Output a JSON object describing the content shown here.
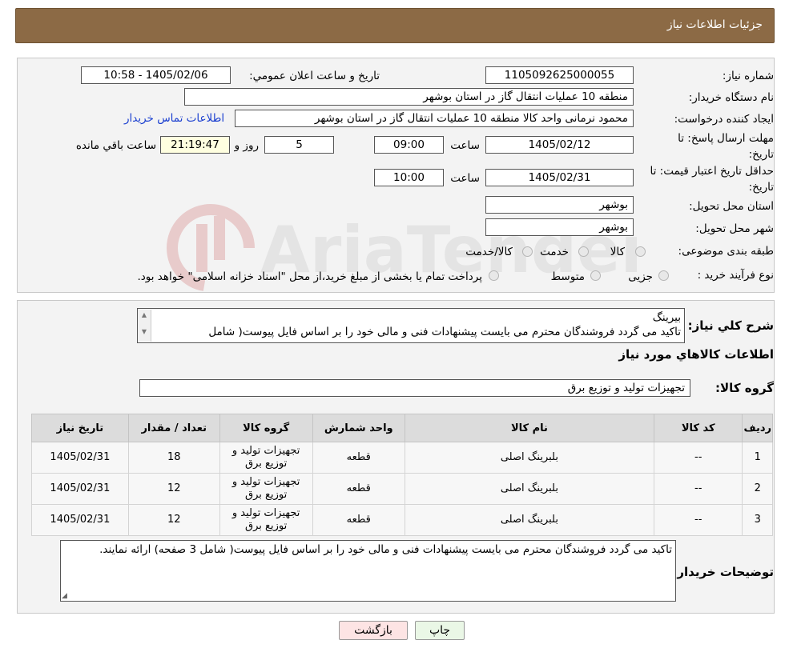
{
  "header": {
    "title": "جزئيات اطلاعات نياز"
  },
  "form": {
    "need_number_label": "شماره نياز:",
    "need_number": "1105092625000055",
    "announce_label": "تاريخ و ساعت اعلان عمومي:",
    "announce_value": "1405/02/06 - 10:58",
    "buyer_org_label": "نام دستگاه خريدار:",
    "buyer_org": "منطقه 10 عملیات انتقال گاز در استان بوشهر",
    "creator_label": "ايجاد کننده درخواست:",
    "creator": "محمود نرمانی واحد کالا منطقه 10 عملیات انتقال گاز در استان بوشهر",
    "contact_link": "اطلاعات تماس خريدار",
    "deadline_label": "مهلت ارسال پاسخ: تا تاريخ:",
    "deadline_date": "1405/02/12",
    "time_label": "ساعت",
    "deadline_time": "09:00",
    "days_value": "5",
    "days_label": "روز و",
    "remaining_value": "21:19:47",
    "remaining_label": "ساعت باقي مانده",
    "validity_label": "حداقل تاريخ اعتبار قيمت: تا تاريخ:",
    "validity_date": "1405/02/31",
    "validity_time_label": "ساعت",
    "validity_time": "10:00",
    "province_label": "استان محل تحويل:",
    "province": "بوشهر",
    "city_label": "شهر محل تحويل:",
    "city": "بوشهر",
    "category_label": "طبقه بندی موضوعی:",
    "category_options": [
      "کالا",
      "خدمت",
      "کالا/خدمت"
    ],
    "purchase_type_label": "نوع فرآيند خريد :",
    "purchase_options": [
      "جزیی",
      "متوسط"
    ],
    "purchase_note": "پرداخت تمام يا بخشی از مبلغ خريد،از محل \"اسناد خزانه اسلامی\" خواهد بود."
  },
  "watermark_text": "AriaTender.neT",
  "description": {
    "label": "شرح کلي نياز:",
    "line1": "بیرینگ",
    "line2": "تاکید می گردد فروشندگان محترم می بایست پیشنهادات فنی و مالی خود را بر اساس فایل پیوست( شامل"
  },
  "goods": {
    "section_title": "اطلاعات کالاهاي مورد نياز",
    "group_label": "گروه کالا:",
    "group_value": "تجهیزات تولید و توزیع برق",
    "columns": [
      "رديف",
      "کد کالا",
      "نام کالا",
      "واحد شمارش",
      "گروه کالا",
      "تعداد / مقدار",
      "تاريخ نياز"
    ],
    "rows": [
      {
        "row": "1",
        "code": "--",
        "name": "بلبرینگ اصلی",
        "unit": "قطعه",
        "group_l1": "تجهیزات تولید و",
        "group_l2": "توزیع برق",
        "qty": "18",
        "date": "1405/02/31"
      },
      {
        "row": "2",
        "code": "--",
        "name": "بلبرینگ اصلی",
        "unit": "قطعه",
        "group_l1": "تجهیزات تولید و",
        "group_l2": "توزیع برق",
        "qty": "12",
        "date": "1405/02/31"
      },
      {
        "row": "3",
        "code": "--",
        "name": "بلبرینگ اصلی",
        "unit": "قطعه",
        "group_l1": "تجهیزات تولید و",
        "group_l2": "توزیع برق",
        "qty": "12",
        "date": "1405/02/31"
      }
    ]
  },
  "buyer_notes": {
    "label": "توضيحات خريدار:",
    "text": "تاکید می گردد فروشندگان محترم می بایست پیشنهادات فنی و مالی خود را بر اساس فایل پیوست( شامل 3 صفحه) ارائه نمایند."
  },
  "buttons": {
    "print": "چاپ",
    "back": "بازگشت"
  },
  "colors": {
    "header_bg": "#8c6a45",
    "link": "#1a3fd0",
    "remaining_bg": "#ffffe0",
    "back_btn_bg": "#fde4e4",
    "print_btn_bg": "#eaf7e6"
  }
}
